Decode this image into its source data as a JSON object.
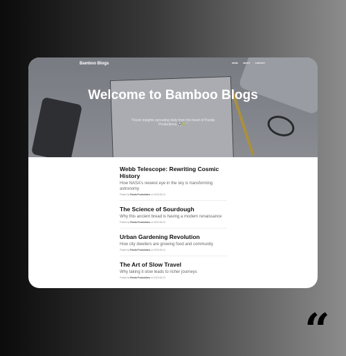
{
  "header": {
    "brand": "Bamboo Blogs",
    "nav": [
      "HOME",
      "ABOUT",
      "CONTACT"
    ]
  },
  "hero": {
    "title": "Welcome to Bamboo Blogs",
    "subtitle": "\"Fresh insights sprouting daily from the heart of Panda Productions 🐼🌱\""
  },
  "posts": [
    {
      "title": "Webb Telescope: Rewriting Cosmic History",
      "subtitle": "How NASA's newest eye in the sky is transforming astronomy",
      "meta_prefix": "Posted by",
      "author": "Panda Productions",
      "meta_suffix": "on 2023-06-24"
    },
    {
      "title": "The Science of Sourdough",
      "subtitle": "Why this ancient bread is having a modern renaissance",
      "meta_prefix": "Posted by",
      "author": "Panda Productions",
      "meta_suffix": "on 2023-06-24"
    },
    {
      "title": "Urban Gardening Revolution",
      "subtitle": "How city dwellers are growing food and community",
      "meta_prefix": "Posted by",
      "author": "Panda Productions",
      "meta_suffix": "on 2023-06-24"
    },
    {
      "title": "The Art of Slow Travel",
      "subtitle": "Why taking it slow leads to richer journeys",
      "meta_prefix": "Posted by",
      "author": "Panda Productions",
      "meta_suffix": "on 2023-06-24"
    }
  ],
  "decor": {
    "quote_mark": "“"
  }
}
